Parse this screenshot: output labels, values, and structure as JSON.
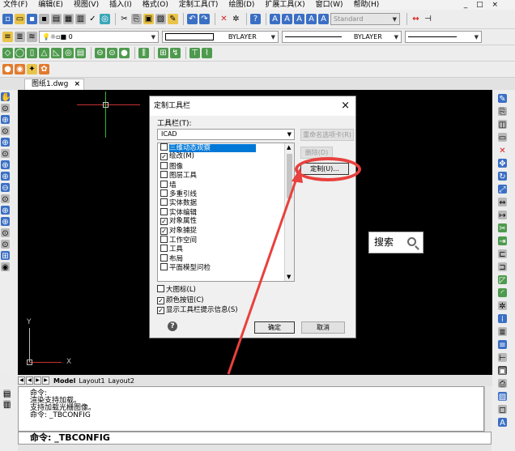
{
  "menubar": [
    "文件(F)",
    "编辑(E)",
    "视图(V)",
    "插入(I)",
    "格式(O)",
    "定制工具(T)",
    "绘图(D)",
    "扩展工具(X)",
    "窗口(W)",
    "帮助(H)"
  ],
  "toolbar1": {
    "style_combo": "Standard"
  },
  "toolbar2": {
    "layer_combo": "0",
    "color_combo": "BYLAYER",
    "linetype_combo": "BYLAYER"
  },
  "tab": {
    "name": "图纸1.dwg",
    "close": "×"
  },
  "dialog": {
    "title": "定制工具栏",
    "close": "×",
    "toolbar_label": "工具栏(T):",
    "group_combo": "ICAD",
    "items": [
      {
        "label": "三维动态观察",
        "checked": false,
        "selected": true
      },
      {
        "label": "绘改(M)",
        "checked": true,
        "selected": false
      },
      {
        "label": "图像",
        "checked": false,
        "selected": false
      },
      {
        "label": "图层工具",
        "checked": false,
        "selected": false
      },
      {
        "label": "墙",
        "checked": false,
        "selected": false
      },
      {
        "label": "多重引线",
        "checked": false,
        "selected": false
      },
      {
        "label": "实体数据",
        "checked": false,
        "selected": false
      },
      {
        "label": "实体编辑",
        "checked": false,
        "selected": false
      },
      {
        "label": "对象属性",
        "checked": true,
        "selected": false
      },
      {
        "label": "对象捕捉",
        "checked": true,
        "selected": false
      },
      {
        "label": "工作空间",
        "checked": false,
        "selected": false
      },
      {
        "label": "工具",
        "checked": false,
        "selected": false
      },
      {
        "label": "布局",
        "checked": false,
        "selected": false
      },
      {
        "label": "平面模型问检",
        "checked": false,
        "selected": false
      }
    ],
    "buttons": {
      "rename": "重命名选项卡(R)",
      "delete": "删除(D)",
      "customize": "定制(U)..."
    },
    "options": [
      {
        "label": "大图标(L)",
        "checked": false
      },
      {
        "label": "颜色按钮(C)",
        "checked": true
      },
      {
        "label": "显示工具栏提示信息(S)",
        "checked": true
      }
    ],
    "help": "?",
    "ok": "确定",
    "cancel": "取消"
  },
  "search": {
    "label": "搜索"
  },
  "ucs": {
    "x": "X",
    "y": "Y"
  },
  "layout_tabs": [
    "Model",
    "Layout1",
    "Layout2"
  ],
  "command_history": [
    "命令:",
    "渲染支持加载。",
    "支持加载光栅图像。",
    "命令: _TBCONFIG"
  ],
  "command_line": "命令:  _TBCONFIG"
}
